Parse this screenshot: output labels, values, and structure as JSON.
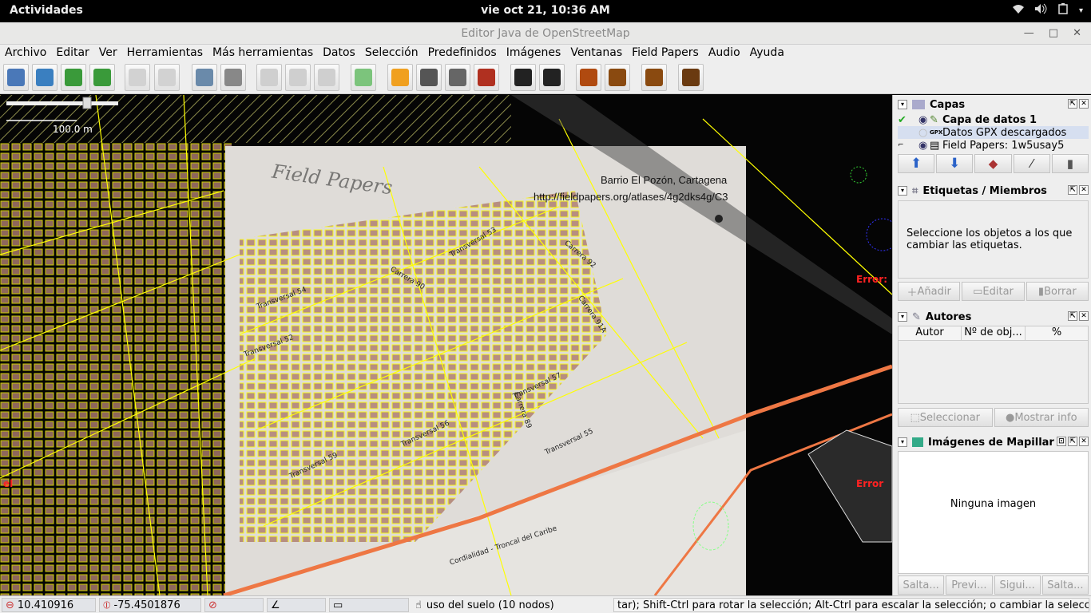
{
  "topbar": {
    "activities": "Actividades",
    "clock": "vie oct 21, 10:36 AM"
  },
  "window": {
    "title": "Editor Java de OpenStreetMap"
  },
  "menu": [
    "Archivo",
    "Editar",
    "Ver",
    "Herramientas",
    "Más herramientas",
    "Datos",
    "Selección",
    "Predefinidos",
    "Imágenes",
    "Ventanas",
    "Field Papers",
    "Audio",
    "Ayuda"
  ],
  "map": {
    "scale": "100.0 m",
    "atlas_title": "Barrio El Pozón, Cartagena",
    "atlas_url": "http://fieldpapers.org/atlases/4g2dks4g/C3",
    "field_papers_mark": "Field Papers",
    "error_1": "Error:",
    "error_2": "Error",
    "edge_label": "el",
    "streets": [
      "Carrera 92",
      "Carrera 91A",
      "Carrera 89",
      "Carrera 90",
      "Transversal 54",
      "Transversal 55",
      "Transversal 57",
      "Transversal 52",
      "Transversal 56",
      "Cordialidad - Troncal del Caribe",
      "Transversal 53",
      "Transversal 59"
    ]
  },
  "panel": {
    "layers": {
      "title": "Capas",
      "items": [
        "Capa de datos 1",
        "Datos GPX descargados",
        "Field Papers: 1w5usay5"
      ]
    },
    "tags": {
      "title": "Etiquetas / Miembros",
      "message": "Seleccione los objetos a los que cambiar las etiquetas.",
      "add": "Añadir",
      "edit": "Editar",
      "delete": "Borrar"
    },
    "authors": {
      "title": "Autores",
      "col_author": "Autor",
      "col_count": "Nº de obj...",
      "col_pct": "%",
      "select": "Seleccionar",
      "info": "Mostrar info"
    },
    "mapillary": {
      "title": "Imágenes de Mapillar",
      "empty": "Ninguna imagen",
      "b1": "Salta...",
      "b2": "Previ...",
      "b3": "Sigui...",
      "b4": "Salta..."
    }
  },
  "status": {
    "lat": "10.410916",
    "lon": "-75.4501876",
    "selection": "uso del suelo (10 nodos)",
    "hint": "tar); Shift-Ctrl para rotar la selección; Alt-Ctrl para escalar la selección; o cambiar la selección"
  },
  "colors": {
    "ways": "#ffff00",
    "road": "#ee7744",
    "error": "#ff2222",
    "panel_bg": "#eeeeee"
  }
}
